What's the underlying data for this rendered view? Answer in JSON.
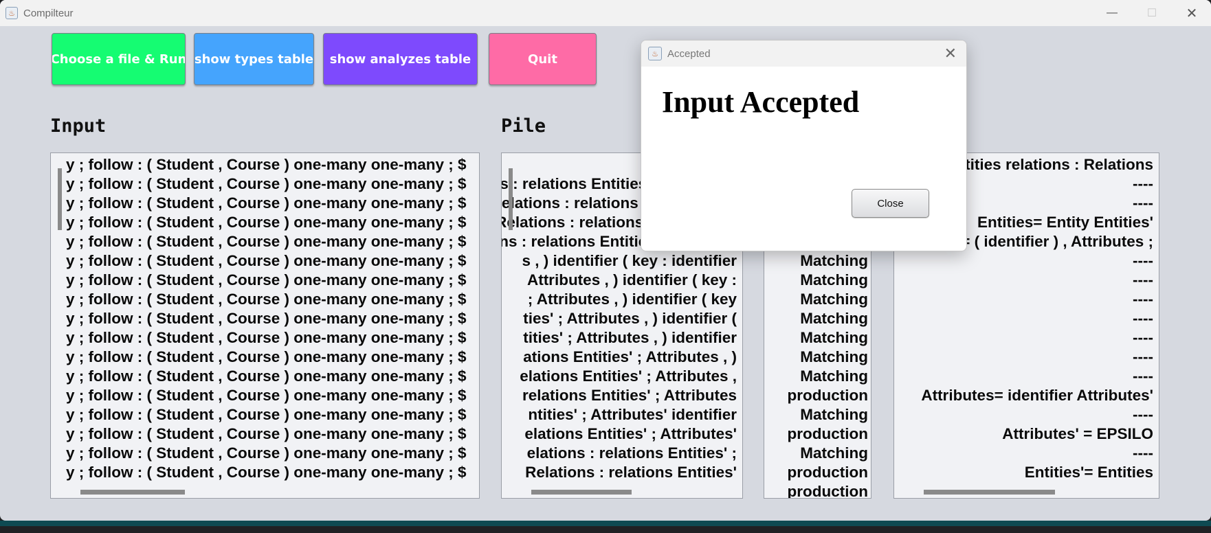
{
  "window": {
    "title": "Compilteur",
    "icon": "java-cup-icon",
    "controls": {
      "minimize": "—",
      "maximize": "☐",
      "close": "✕"
    }
  },
  "toolbar": {
    "run_label": "Choose a file  & Run",
    "types_label": "show types table",
    "analyze_label": "show analyzes table",
    "quit_label": "Quit",
    "colors": {
      "run": "#15fc72",
      "types": "#45a4fd",
      "analyze": "#7e4afd",
      "quit": "#fe6ba6"
    }
  },
  "sections": {
    "input_label": "Input",
    "pile_label": "Pile"
  },
  "input_panel": {
    "lines": [
      "y ; follow : ( Student , Course ) one-many one-many ; $",
      "y ; follow : ( Student , Course ) one-many one-many ; $",
      "y ; follow : ( Student , Course ) one-many one-many ; $",
      "y ; follow : ( Student , Course ) one-many one-many ; $",
      "y ; follow : ( Student , Course ) one-many one-many ; $",
      "y ; follow : ( Student , Course ) one-many one-many ; $",
      "y ; follow : ( Student , Course ) one-many one-many ; $",
      "y ; follow : ( Student , Course ) one-many one-many ; $",
      "y ; follow : ( Student , Course ) one-many one-many ; $",
      "y ; follow : ( Student , Course ) one-many one-many ; $",
      "y ; follow : ( Student , Course ) one-many one-many ; $",
      "y ; follow : ( Student , Course ) one-many one-many ; $",
      "y ; follow : ( Student , Course ) one-many one-many ; $",
      "y ; follow : ( Student , Course ) one-many one-many ; $",
      "y ; follow : ( Student , Course ) one-many one-many ; $",
      "y ; follow : ( Student , Course ) one-many one-many ; $",
      "y ; follow : ( Student , Course ) one-many one-many ; $"
    ]
  },
  "pile_panel": {
    "lines": [
      "",
      "s : relations Entities' ; Attributes",
      "Relations : relations Entities' ; Att",
      " Relations : relations Entities' ; At",
      "ons : relations Entities' ; Attribute",
      "s , ) identifier ( key : identifier",
      " Attributes , ) identifier ( key :",
      "; Attributes , ) identifier ( key",
      "ties' ; Attributes , ) identifier (",
      "tities' ; Attributes , ) identifier",
      "ations Entities' ; Attributes , )",
      "elations Entities' ; Attributes ,",
      "relations Entities' ; Attributes",
      "ntities' ; Attributes' identifier",
      "elations Entities' ; Attributes'",
      "elations : relations Entities' ;",
      "Relations : relations Entities'"
    ]
  },
  "action_panel": {
    "lines": [
      "",
      "",
      "",
      "",
      "",
      "Matching",
      "Matching",
      "Matching",
      "Matching",
      "Matching",
      "Matching",
      "Matching",
      "production",
      "Matching",
      "production",
      "Matching",
      "production",
      "production"
    ]
  },
  "production_panel": {
    "lines": [
      "Entities relations : Relations",
      "----",
      "----",
      "Entities= Entity Entities'",
      "Entity= ( identifier ) , Attributes ;",
      "----",
      "----",
      "----",
      "----",
      "----",
      "----",
      "----",
      "Attributes= identifier Attributes'",
      "----",
      "Attributes' = EPSILO",
      "----",
      "Entities'= Entities"
    ]
  },
  "dialog": {
    "title": "Accepted",
    "icon": "java-cup-icon",
    "message": "Input Accepted",
    "close_button": "Close",
    "close_x": "✕"
  }
}
